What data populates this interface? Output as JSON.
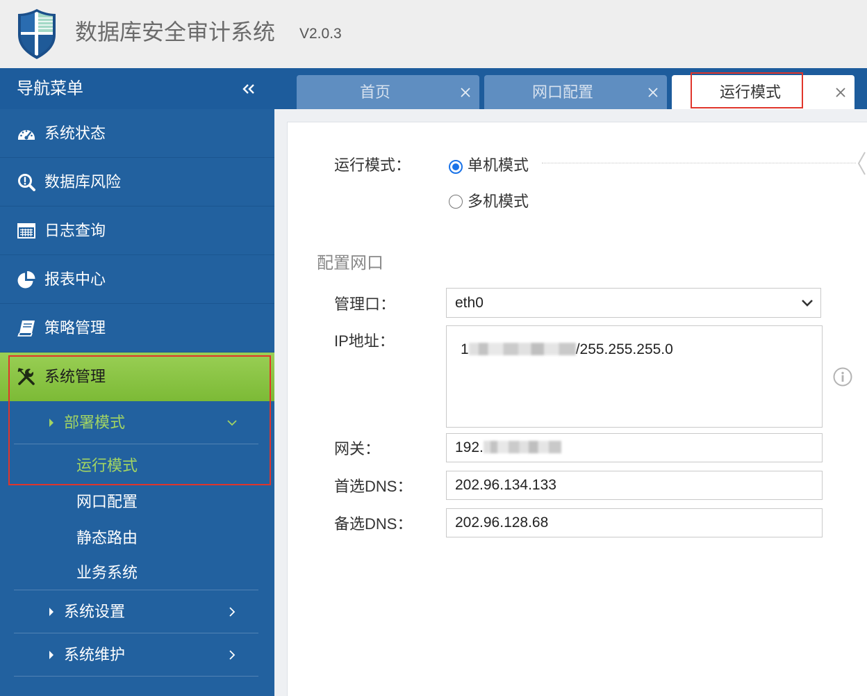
{
  "header": {
    "title": "数据库安全审计系统",
    "version": "V2.0.3",
    "logo_icon": "shield-logo-icon"
  },
  "sidebar": {
    "title": "导航菜单",
    "collapse_icon": "double-chevron-left-icon",
    "items": [
      {
        "label": "系统状态",
        "icon": "dashboard-icon"
      },
      {
        "label": "数据库风险",
        "icon": "search-icon"
      },
      {
        "label": "日志查询",
        "icon": "table-icon"
      },
      {
        "label": "报表中心",
        "icon": "pie-chart-icon"
      },
      {
        "label": "策略管理",
        "icon": "book-icon"
      },
      {
        "label": "系统管理",
        "icon": "tools-icon",
        "active": true
      }
    ],
    "submenu": [
      {
        "label": "部署模式",
        "expanded": true,
        "children": [
          {
            "label": "运行模式",
            "active": true
          },
          {
            "label": "网口配置"
          },
          {
            "label": "静态路由"
          },
          {
            "label": "业务系统"
          }
        ]
      },
      {
        "label": "系统设置",
        "expanded": false
      },
      {
        "label": "系统维护",
        "expanded": false
      }
    ]
  },
  "tabs": [
    {
      "label": "首页",
      "active": false
    },
    {
      "label": "网口配置",
      "active": false
    },
    {
      "label": "运行模式",
      "active": true
    }
  ],
  "content": {
    "run_mode": {
      "label": "运行模式：",
      "options": [
        {
          "label": "单机模式",
          "checked": true
        },
        {
          "label": "多机模式",
          "checked": false
        }
      ]
    },
    "section_title": "配置网口",
    "fields": {
      "mgmt_port": {
        "label": "管理口：",
        "value": "eth0"
      },
      "ip": {
        "label": "IP地址：",
        "value_visible_start": "1",
        "value_visible_end": "/255.255.255.0"
      },
      "gateway": {
        "label": "网关：",
        "value_visible_start": "192."
      },
      "dns1": {
        "label": "首选DNS：",
        "value": "202.96.134.133"
      },
      "dns2": {
        "label": "备选DNS：",
        "value": "202.96.128.68"
      }
    }
  },
  "colors": {
    "header_bg": "#eeeeee",
    "nav_blue": "#22619f",
    "nav_dark_blue": "#1d5c9c",
    "active_green": "#8cc63f",
    "submenu_active_text": "#a2d463",
    "tab_inactive": "#5f8ec1",
    "highlight_red": "#e0352b",
    "radio_blue": "#1a73e8"
  }
}
